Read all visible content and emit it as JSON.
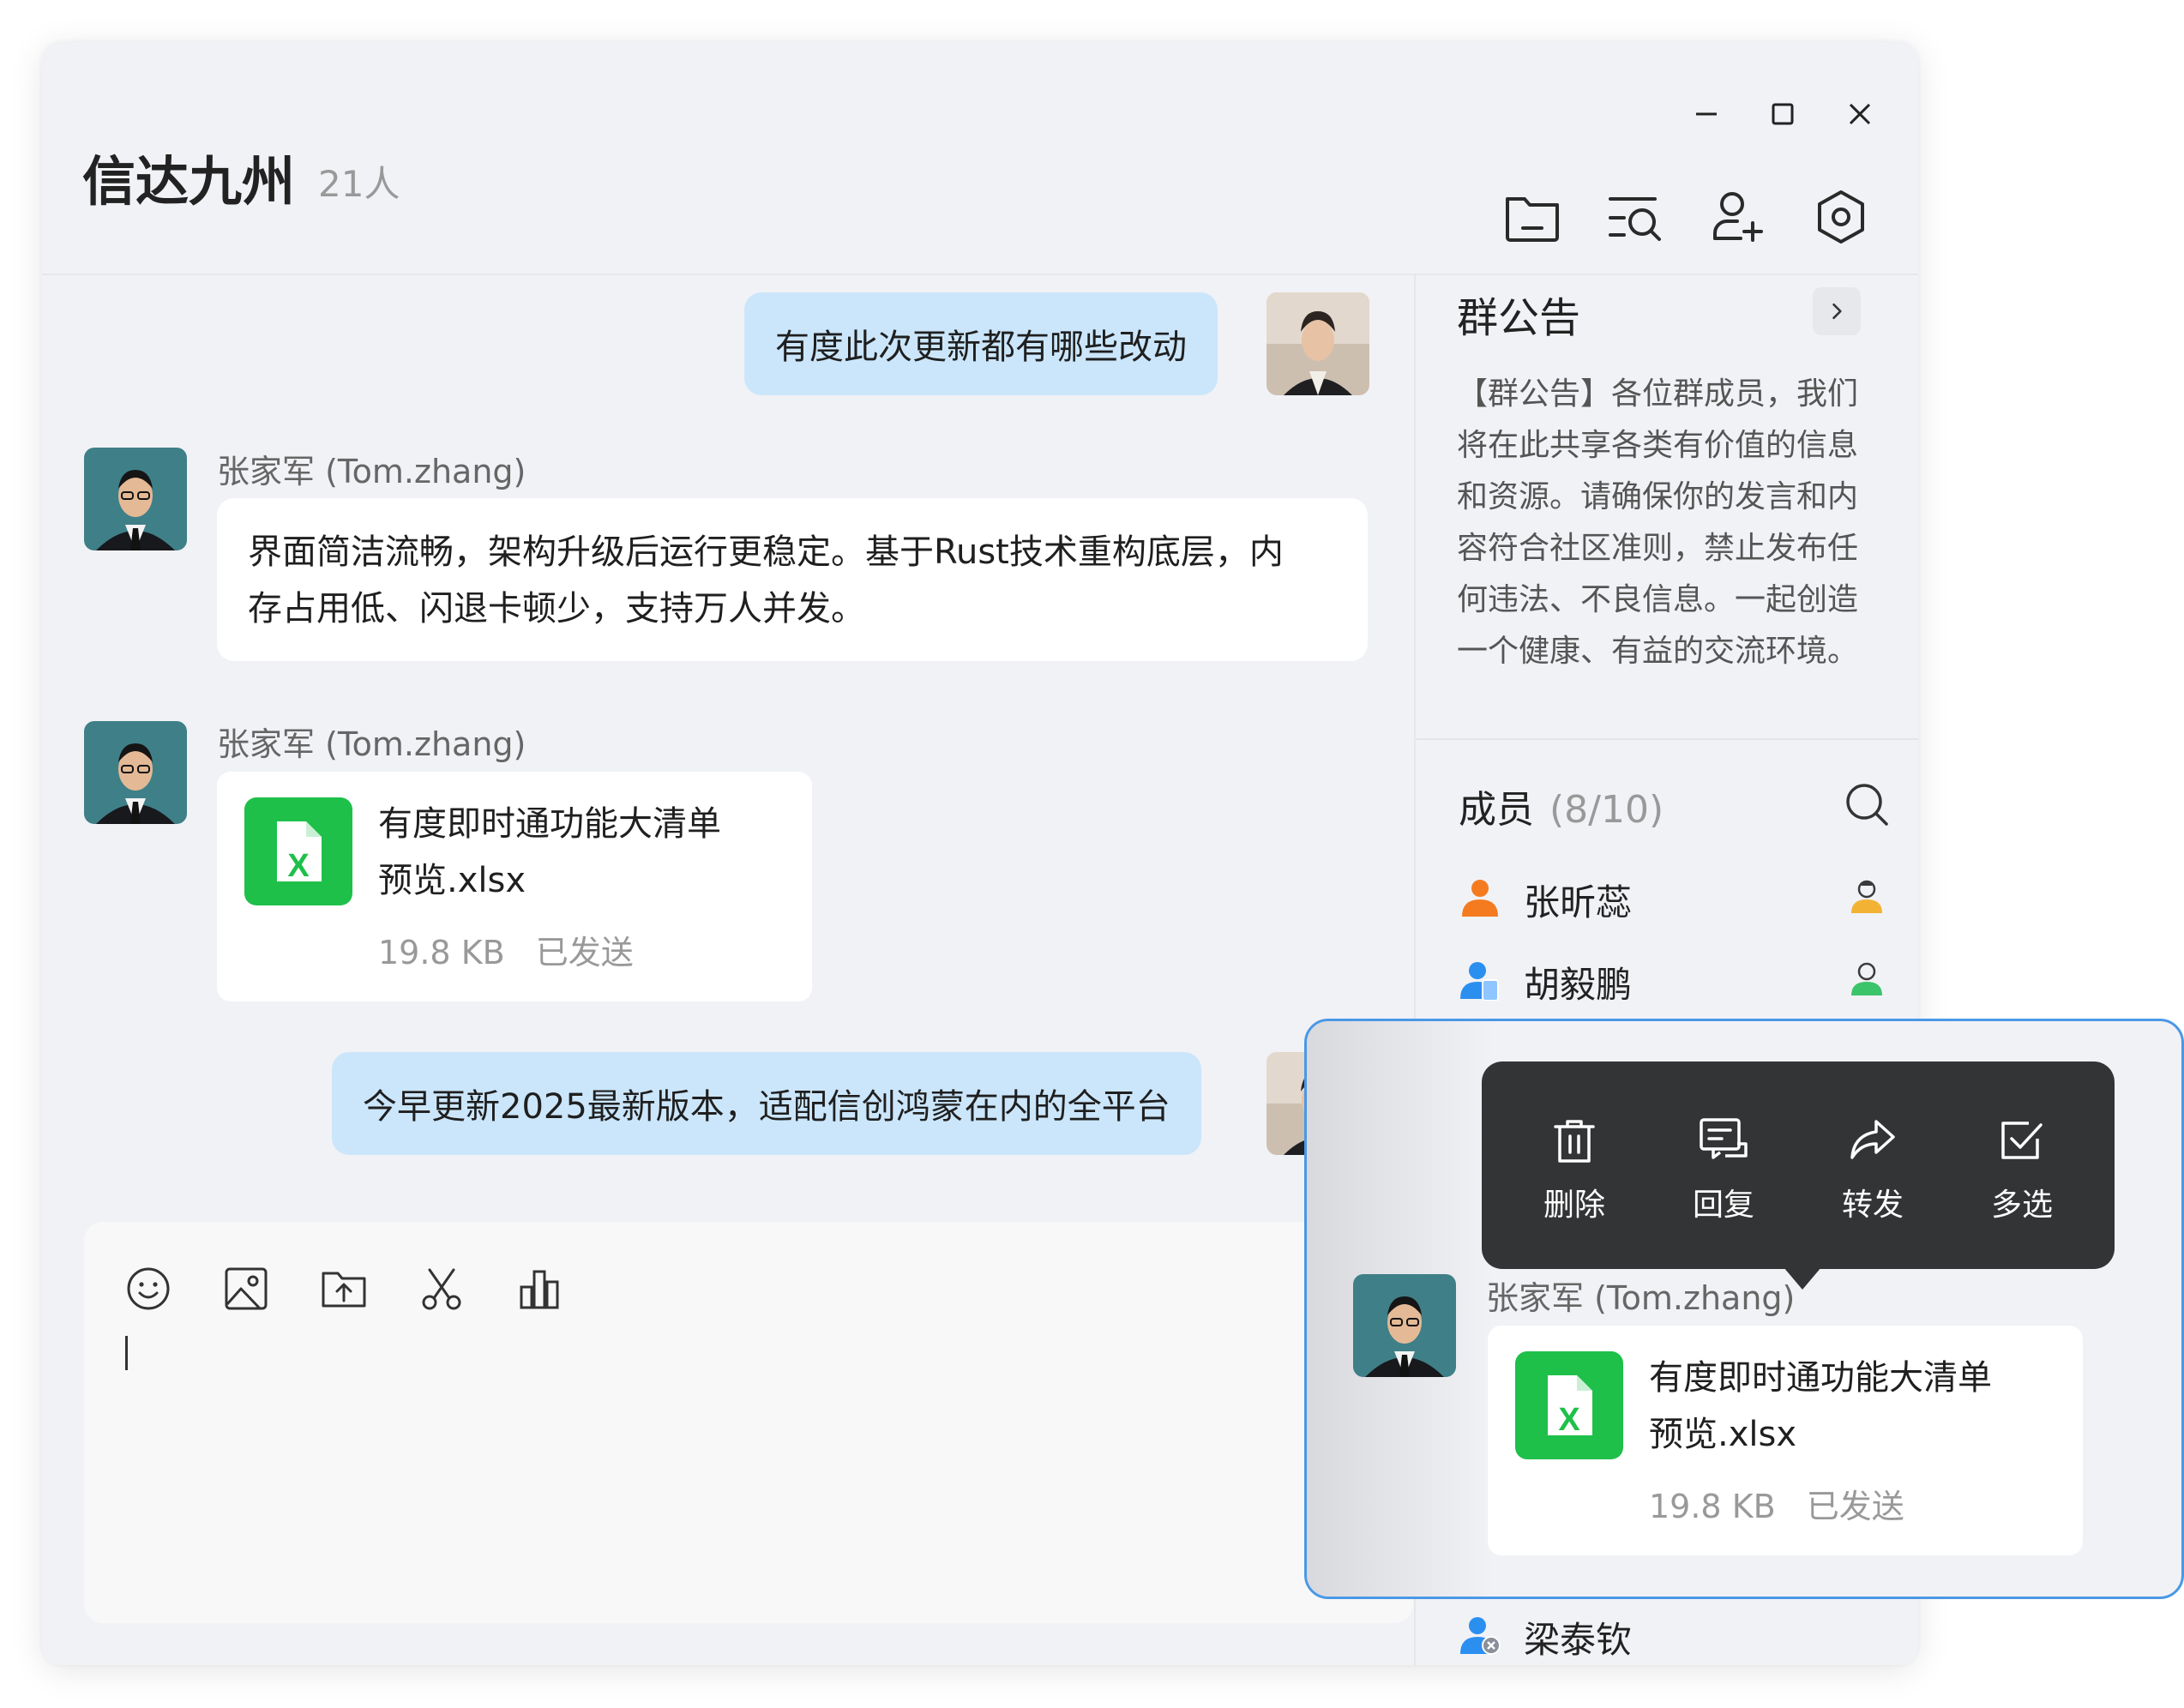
{
  "window": {
    "title": "信达九州",
    "member_count": "21人"
  },
  "chat": {
    "messages": [
      {
        "type": "text",
        "side": "right",
        "text": "有度此次更新都有哪些改动"
      },
      {
        "type": "text",
        "side": "left",
        "sender": "张家军 (Tom.zhang)",
        "line1": "界面简洁流畅，架构升级后运行更稳定。基于Rust技术重构底层，内",
        "line2": "存占用低、闪退卡顿少，支持万人并发。"
      },
      {
        "type": "file",
        "side": "left",
        "sender": "张家军 (Tom.zhang)",
        "file_name_line1": "有度即时通功能大清单",
        "file_name_line2": "预览.xlsx",
        "file_size": "19.8 KB",
        "status": "已发送"
      },
      {
        "type": "text",
        "side": "right",
        "text": "今早更新2025最新版本，适配信创鸿蒙在内的全平台"
      }
    ]
  },
  "sidebar": {
    "notice_title": "群公告",
    "notice_lines": [
      "【群公告】各位群成员，我们",
      "将在此共享各类有价值的信息",
      "和资源。请确保你的发言和内",
      "容符合社区准则，禁止发布任",
      "何违法、不良信息。一起创造",
      "一个健康、有益的交流环境。"
    ],
    "members_title": "成员",
    "members_count": "(8/10)",
    "members": [
      {
        "name": "张昕蕊",
        "icon_color": "#f47b20"
      },
      {
        "name": "胡毅鹏",
        "icon_color": "#2b8ff0"
      },
      {
        "name": "梁泰钦",
        "icon_color": "#2b8ff0"
      }
    ]
  },
  "context_menu": {
    "items": [
      {
        "label": "删除",
        "icon": "trash-icon"
      },
      {
        "label": "回复",
        "icon": "reply-icon"
      },
      {
        "label": "转发",
        "icon": "forward-icon"
      },
      {
        "label": "多选",
        "icon": "checkbox-icon"
      }
    ]
  },
  "popup_message": {
    "sender": "张家军 (Tom.zhang)",
    "file_name_line1": "有度即时通功能大清单",
    "file_name_line2": "预览.xlsx",
    "file_size": "19.8 KB",
    "status": "已发送"
  },
  "colors": {
    "accent": "#4a98e6",
    "bubble_self": "#cbe6fb",
    "excel_green": "#1ec04a",
    "menu_bg": "#333436"
  }
}
